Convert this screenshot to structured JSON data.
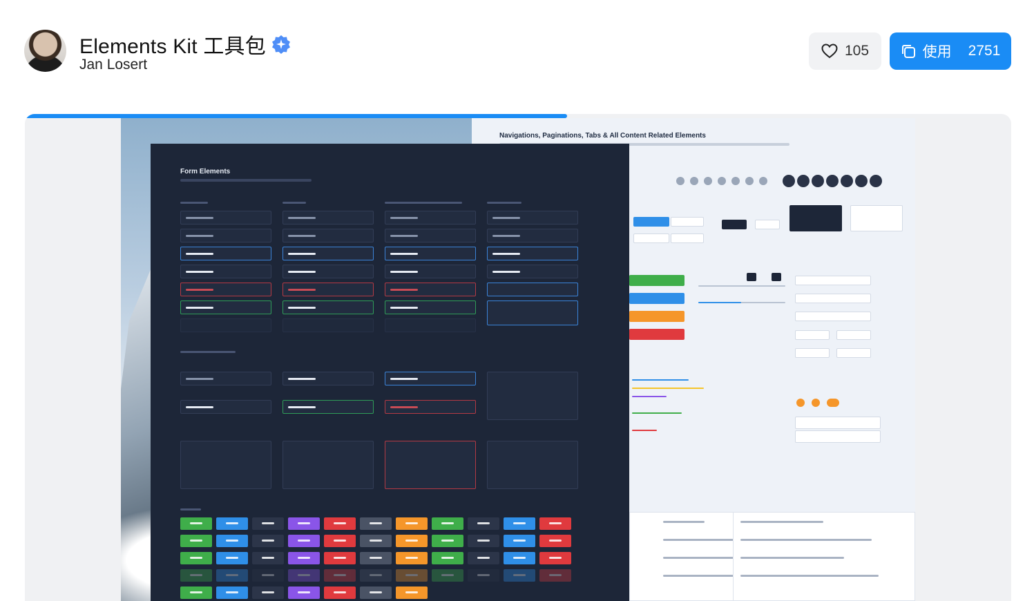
{
  "header": {
    "title": "Elements Kit 工具包",
    "author": "Jan Losert",
    "likes": "105",
    "use_label": "使用",
    "use_count": "2751"
  },
  "colors": {
    "accent": "#1a8cf5",
    "dark_panel": "#1d2638",
    "light_panel": "#eef2f8"
  },
  "icons": {
    "verified": "verified-badge-icon",
    "like": "heart-icon",
    "use": "copy-icon"
  },
  "preview": {
    "carousel_progress": 0.55,
    "form_panel_title": "Form Elements",
    "nav_panel_title": "Navigations, Paginations, Tabs & All Content Related Elements"
  }
}
